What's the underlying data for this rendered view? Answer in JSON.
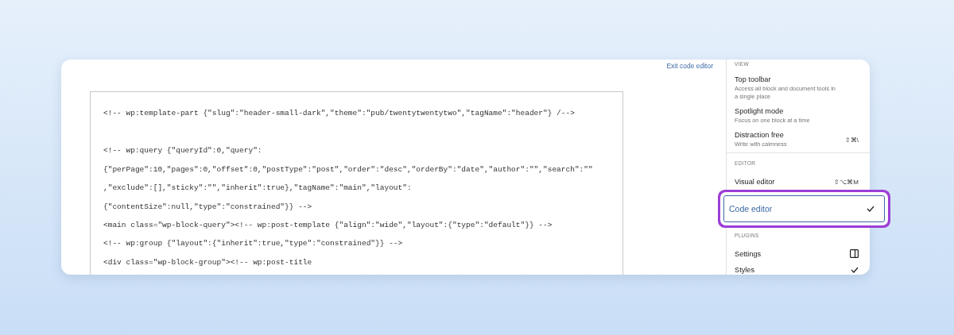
{
  "exit_link": "Exit code editor",
  "code_blocks": [
    [
      "<!-- wp:template-part {\"slug\":\"header-small-dark\",\"theme\":\"pub/twentytwentytwo\",\"tagName\":\"header\"} /-->"
    ],
    [
      "<!-- wp:query {\"queryId\":0,\"query\":",
      "{\"perPage\":10,\"pages\":0,\"offset\":0,\"postType\":\"post\",\"order\":\"desc\",\"orderBy\":\"date\",\"author\":\"\",\"search\":\"\"",
      ",\"exclude\":[],\"sticky\":\"\",\"inherit\":true},\"tagName\":\"main\",\"layout\":",
      "{\"contentSize\":null,\"type\":\"constrained\"}} -->",
      "<main class=\"wp-block-query\"><!-- wp:post-template {\"align\":\"wide\",\"layout\":{\"type\":\"default\"}} -->",
      "<!-- wp:group {\"layout\":{\"inherit\":true,\"type\":\"constrained\"}} -->",
      "<div class=\"wp-block-group\"><!-- wp:post-title"
    ]
  ],
  "menu": [
    {
      "heading": "VIEW",
      "divider": false,
      "items": [
        {
          "label": "Top toolbar",
          "description": "Access all block and document tools in a single place",
          "selected": false
        },
        {
          "label": "Spotlight mode",
          "description": "Focus on one block at a time",
          "selected": false
        },
        {
          "label": "Distraction free",
          "description": "Write with calmness",
          "shortcut": "⇧⌘\\",
          "selected": false
        }
      ]
    },
    {
      "heading": "EDITOR",
      "divider": true,
      "items": [
        {
          "label": "Visual editor",
          "shortcut": "⇧⌥⌘M",
          "selected": false
        },
        {
          "label": "Code editor",
          "selected": true
        }
      ]
    },
    {
      "heading": "PLUGINS",
      "divider": false,
      "items": [
        {
          "label": "Settings",
          "kind": "panel",
          "selected": false
        },
        {
          "label": "Styles",
          "kind": "check",
          "selected": false
        }
      ]
    }
  ]
}
